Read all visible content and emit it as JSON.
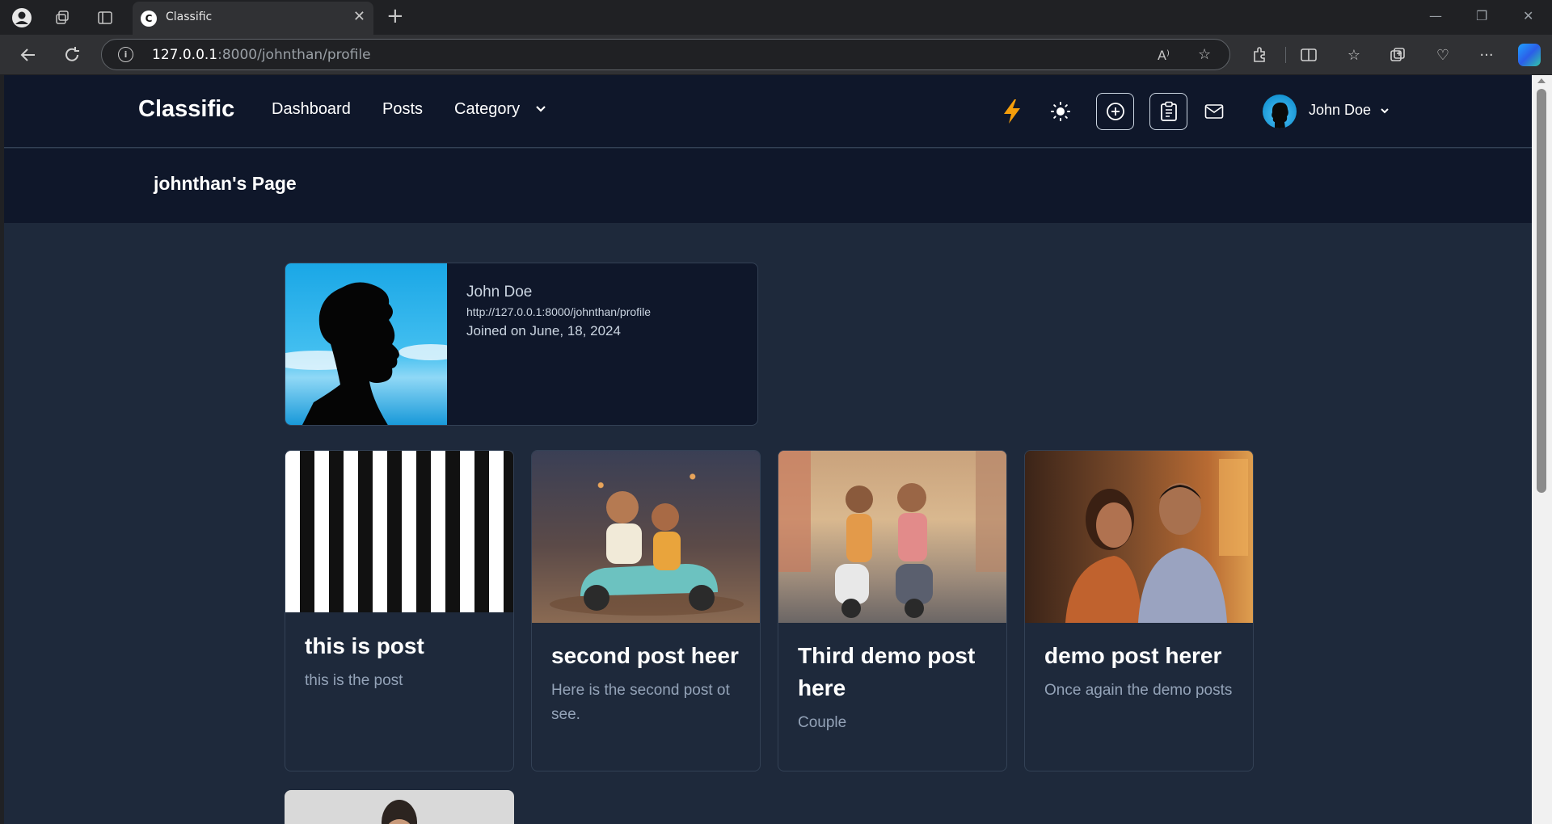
{
  "browser": {
    "tab_title": "Classific",
    "tab_favicon": "C",
    "url_host": "127.0.0.1",
    "url_path": ":8000/johnthan/profile"
  },
  "header": {
    "brand": "Classific",
    "nav": {
      "dashboard": "Dashboard",
      "posts": "Posts",
      "category": "Category"
    },
    "user_name": "John Doe",
    "accent_color": "#f59e0b"
  },
  "page": {
    "title": "johnthan's Page"
  },
  "profile": {
    "name": "John Doe",
    "url": "http://127.0.0.1:8000/johnthan/profile",
    "joined": "Joined on June, 18, 2024"
  },
  "posts": [
    {
      "title": "this is post",
      "body": "this is the post"
    },
    {
      "title": "second post heer",
      "body": "Here is the second post ot see."
    },
    {
      "title": "Third demo post here",
      "body": "Couple"
    },
    {
      "title": "demo post herer",
      "body": "Once again the demo posts"
    }
  ]
}
